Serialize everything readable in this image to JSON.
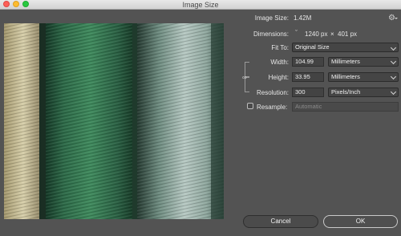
{
  "window": {
    "title": "Image Size"
  },
  "info": {
    "image_size_label": "Image Size:",
    "image_size_value": "1.42M",
    "dimensions_label": "Dimensions:",
    "dimensions_width": "1240 px",
    "dimensions_sep": "×",
    "dimensions_height": "401 px"
  },
  "fit_to": {
    "label": "Fit To:",
    "value": "Original Size"
  },
  "width": {
    "label": "Width:",
    "value": "104.99",
    "unit": "Millimeters"
  },
  "height": {
    "label": "Height:",
    "value": "33.95",
    "unit": "Millimeters"
  },
  "resolution": {
    "label": "Resolution:",
    "value": "300",
    "unit": "Pixels/Inch"
  },
  "resample": {
    "label": "Resample:",
    "value": "Automatic",
    "checked": false
  },
  "buttons": {
    "cancel": "Cancel",
    "ok": "OK"
  },
  "icons": {
    "settings": "gear-icon",
    "link": "chain-link-icon"
  }
}
